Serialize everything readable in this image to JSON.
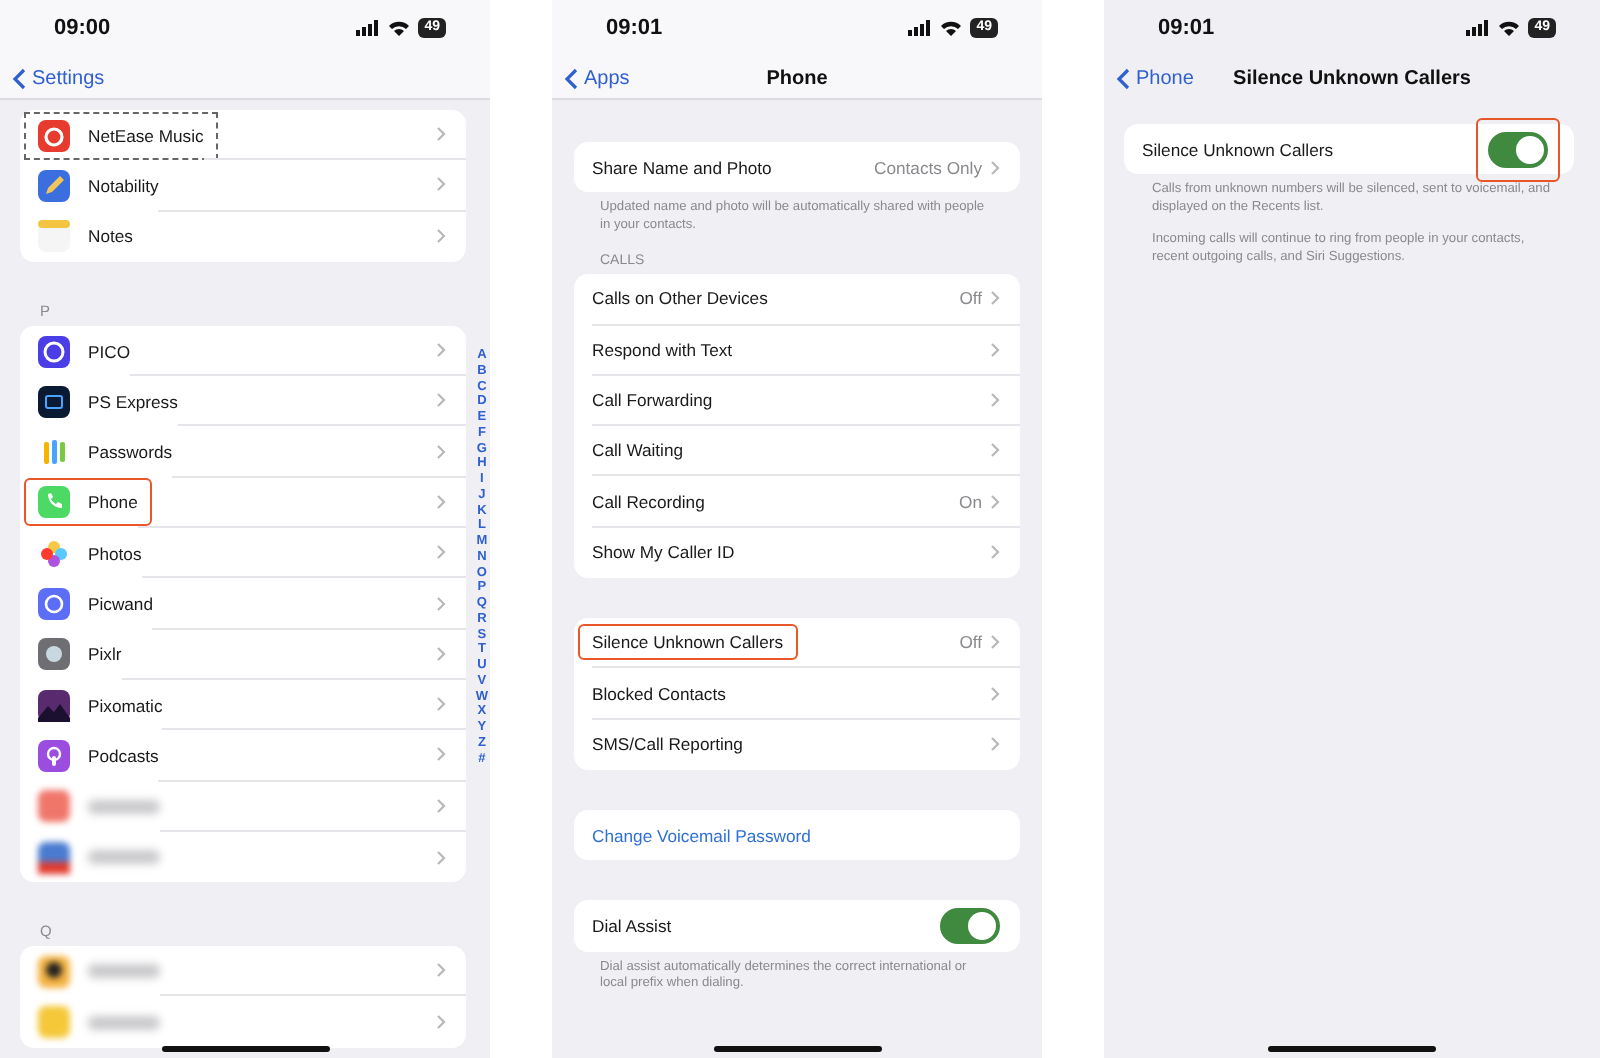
{
  "settings_screen": {
    "status": {
      "time": "09:00",
      "battery": "49"
    },
    "back": "Settings",
    "groups": [
      {
        "rows": [
          {
            "label": "NetEase Music",
            "dashed_outline": true,
            "highlighted": false,
            "blurred": false
          },
          {
            "label": "Notability",
            "dashed_outline": false,
            "highlighted": false,
            "blurred": false
          },
          {
            "label": "Notes",
            "dashed_outline": false,
            "highlighted": false,
            "blurred": false
          }
        ]
      },
      {
        "letter": "P",
        "rows": [
          {
            "label": "PICO",
            "dashed_outline": false,
            "highlighted": false,
            "blurred": false
          },
          {
            "label": "PS Express",
            "dashed_outline": false,
            "highlighted": false,
            "blurred": false
          },
          {
            "label": "Passwords",
            "dashed_outline": false,
            "highlighted": false,
            "blurred": false
          },
          {
            "label": "Phone",
            "dashed_outline": false,
            "highlighted": true,
            "blurred": false
          },
          {
            "label": "Photos",
            "dashed_outline": false,
            "highlighted": false,
            "blurred": false
          },
          {
            "label": "Picwand",
            "dashed_outline": false,
            "highlighted": false,
            "blurred": false
          },
          {
            "label": "Pixlr",
            "dashed_outline": false,
            "highlighted": false,
            "blurred": false
          },
          {
            "label": "Pixomatic",
            "dashed_outline": false,
            "highlighted": false,
            "blurred": false
          },
          {
            "label": "Podcasts",
            "dashed_outline": false,
            "highlighted": false,
            "blurred": false
          },
          {
            "dashed_outline": false,
            "highlighted": false,
            "blurred": true
          },
          {
            "dashed_outline": false,
            "highlighted": false,
            "blurred": true
          }
        ]
      },
      {
        "letter": "Q",
        "rows": [
          {
            "dashed_outline": false,
            "highlighted": false,
            "blurred": true
          },
          {
            "dashed_outline": false,
            "highlighted": false,
            "blurred": true
          }
        ]
      }
    ],
    "index_letters": [
      "A",
      "B",
      "C",
      "D",
      "E",
      "F",
      "G",
      "H",
      "I",
      "J",
      "K",
      "L",
      "M",
      "N",
      "O",
      "P",
      "Q",
      "R",
      "S",
      "T",
      "U",
      "V",
      "W",
      "X",
      "Y",
      "Z",
      "#"
    ]
  },
  "phone_screen": {
    "status": {
      "time": "09:01",
      "battery": "49"
    },
    "back": "Apps",
    "title": "Phone",
    "sections": [
      {
        "rows": [
          {
            "kind": "nav",
            "label": "Share Name and Photo",
            "value": "Contacts Only",
            "highlighted": false
          }
        ],
        "footer": "Updated name and photo will be automatically shared with people in your contacts."
      },
      {
        "header": "CALLS",
        "rows": [
          {
            "kind": "nav",
            "label": "Calls on Other Devices",
            "value": "Off",
            "highlighted": false
          },
          {
            "kind": "nav",
            "label": "Respond with Text",
            "highlighted": false
          },
          {
            "kind": "nav",
            "label": "Call Forwarding",
            "highlighted": false
          },
          {
            "kind": "nav",
            "label": "Call Waiting",
            "highlighted": false
          },
          {
            "kind": "nav",
            "label": "Call Recording",
            "value": "On",
            "highlighted": false
          },
          {
            "kind": "nav",
            "label": "Show My Caller ID",
            "highlighted": false
          }
        ]
      },
      {
        "rows": [
          {
            "kind": "nav",
            "label": "Silence Unknown Callers",
            "value": "Off",
            "highlighted": true
          },
          {
            "kind": "nav",
            "label": "Blocked Contacts",
            "highlighted": false
          },
          {
            "kind": "nav",
            "label": "SMS/Call Reporting",
            "highlighted": false
          }
        ]
      },
      {
        "rows": [
          {
            "kind": "link",
            "label": "Change Voicemail Password",
            "highlighted": false
          }
        ]
      },
      {
        "rows": [
          {
            "kind": "toggle",
            "label": "Dial Assist",
            "on": true,
            "highlighted": false
          }
        ],
        "footer": "Dial assist automatically determines the correct international or local prefix when dialing."
      }
    ]
  },
  "silence_screen": {
    "status": {
      "time": "09:01",
      "battery": "49"
    },
    "back": "Phone",
    "title": "Silence Unknown Callers",
    "rows": [
      {
        "kind": "toggle",
        "label": "Silence Unknown Callers",
        "on": true,
        "toggle_highlighted": true
      }
    ],
    "footers": [
      "Calls from unknown numbers will be silenced, sent to voicemail, and displayed on the Recents list.",
      "Incoming calls will continue to ring from people in your contacts, recent outgoing calls, and Siri Suggestions."
    ]
  }
}
